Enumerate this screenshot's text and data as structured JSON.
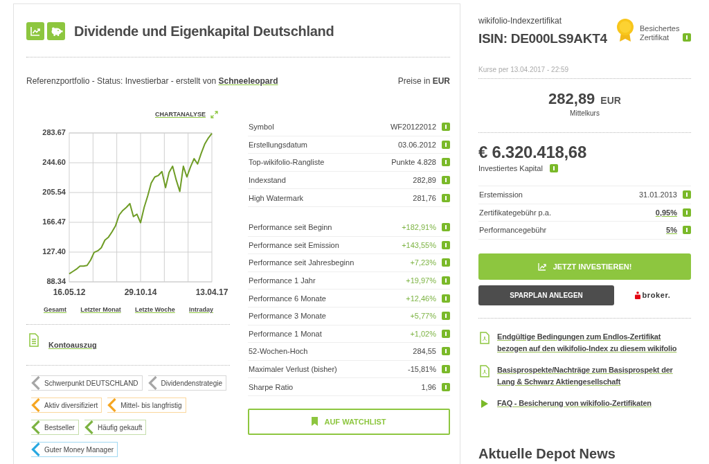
{
  "header": {
    "title": "Dividende und Eigenkapital Deutschland"
  },
  "status": {
    "text": "Referenzportfolio - Status: Investierbar - erstellt von",
    "author": "Schneeleopard",
    "prices": "Preise in **EUR**"
  },
  "chart": {
    "analysis_link": "CHARTANALYSE",
    "chart_data": {
      "type": "line",
      "categories": [
        "16.05.12",
        null,
        null,
        null,
        null,
        null,
        null,
        null,
        null,
        null,
        null,
        null,
        null,
        null,
        null,
        null,
        null,
        null,
        null,
        null,
        "29.10.14",
        null,
        null,
        null,
        null,
        null,
        null,
        null,
        null,
        null,
        null,
        null,
        null,
        null,
        null,
        null,
        null,
        null,
        null,
        null,
        "13.04.17"
      ],
      "values": [
        99,
        102,
        105,
        109,
        109,
        110,
        117,
        127,
        129,
        133,
        143,
        147,
        154,
        162,
        176,
        182,
        186,
        191,
        174,
        177,
        166,
        186,
        201,
        218,
        226,
        228,
        233,
        212,
        232,
        240,
        222,
        207,
        240,
        226,
        239,
        250,
        243,
        257,
        269,
        277,
        283
      ],
      "ylim": [
        88.34,
        283.67
      ],
      "yticks": [
        {
          "value": 88.34,
          "label": "88.34"
        },
        {
          "value": 127.4,
          "label": "127.40"
        },
        {
          "value": 166.47,
          "label": "166.47"
        },
        {
          "value": 205.54,
          "label": "205.54"
        },
        {
          "value": 244.6,
          "label": "244.60"
        },
        {
          "value": 283.67,
          "label": "283.67"
        }
      ],
      "grid": true
    },
    "ranges": [
      "Gesamt",
      "Letzter Monat",
      "Letzte Woche",
      "Intraday"
    ]
  },
  "statement_link": "Kontoauszug",
  "tags": [
    {
      "label": "Schwerpunkt DEUTSCHLAND",
      "color": "#a6a6a6"
    },
    {
      "label": "Dividendenstrategie",
      "color": "#a6a6a6"
    },
    {
      "label": "Aktiv diversifiziert",
      "color": "#f5a623"
    },
    {
      "label": "Mittel- bis langfristig",
      "color": "#f5a623"
    },
    {
      "label": "Bestseller",
      "color": "#7cb342"
    },
    {
      "label": "Häufig gekauft",
      "color": "#7cb342"
    },
    {
      "label": "Guter Money Manager",
      "color": "#29a9e1"
    }
  ],
  "key_figures": [
    {
      "label": "Symbol",
      "value": "WF20122012",
      "kind": "plain"
    },
    {
      "label": "Erstellungsdatum",
      "value": "03.06.2012",
      "kind": "plain"
    },
    {
      "label": "Top-wikifolio-Rangliste",
      "value": "Punkte 4.828",
      "kind": "plain"
    },
    {
      "label": "Indexstand",
      "value": "282,89",
      "kind": "plain"
    },
    {
      "label": "High Watermark",
      "value": "281,76",
      "kind": "plain"
    }
  ],
  "performance": [
    {
      "label": "Performance seit Beginn",
      "value": "+182,91%",
      "kind": "gain"
    },
    {
      "label": "Performance seit Emission",
      "value": "+143,55%",
      "kind": "gain"
    },
    {
      "label": "Performance seit Jahresbeginn",
      "value": "+7,23%",
      "kind": "gain"
    },
    {
      "label": "Performance 1 Jahr",
      "value": "+19,97%",
      "kind": "gain"
    },
    {
      "label": "Performance 6 Monate",
      "value": "+12,46%",
      "kind": "gain"
    },
    {
      "label": "Performance 3 Monate",
      "value": "+5,77%",
      "kind": "gain"
    },
    {
      "label": "Performance 1 Monat",
      "value": "+1,02%",
      "kind": "gain"
    },
    {
      "label": "52-Wochen-Hoch",
      "value": "284,55",
      "kind": "plain"
    },
    {
      "label": "Maximaler Verlust (bisher)",
      "value": "-15,81%",
      "kind": "plain"
    },
    {
      "label": "Sharpe Ratio",
      "value": "1,96",
      "kind": "plain"
    }
  ],
  "watchlist_button": "AUF WATCHLIST",
  "certificate": {
    "type": "wikifolio-Indexzertifikat",
    "isin": "ISIN: DE000LS9AKT4",
    "secured": "Besichertes Zertifikat"
  },
  "quote": {
    "timestamp": "Kurse per 13.04.2017 - 22:59",
    "price": "282,89",
    "currency": "EUR",
    "label": "Mittelkurs"
  },
  "capital": {
    "value": "€ 6.320.418,68",
    "label": "Investiertes Kapital"
  },
  "facts": [
    {
      "label": "Erstemission",
      "value": "31.01.2013",
      "kind": "plain"
    },
    {
      "label": "Zertifikategebühr p.a.",
      "value": "0,95%",
      "kind": "link"
    },
    {
      "label": "Performancegebühr",
      "value": "5%",
      "kind": "link"
    }
  ],
  "buttons": {
    "invest": "JETZT INVESTIEREN!",
    "savings_plan": "SPARPLAN ANLEGEN"
  },
  "broker_logo": "broker.",
  "documents": [
    {
      "kind": "pdf",
      "label": "Endgültige Bedingungen zum Endlos-Zertifikat bezogen auf den wikifolio-Index zu diesem wikifolio"
    },
    {
      "kind": "pdf",
      "label": "Basisprospekte/Nachträge zum Basisprospekt der Lang & Schwarz Aktiengesellschaft"
    },
    {
      "kind": "play",
      "label": "FAQ - Besicherung von wikifolio-Zertifikaten"
    }
  ],
  "news_heading": "Aktuelle Depot News"
}
